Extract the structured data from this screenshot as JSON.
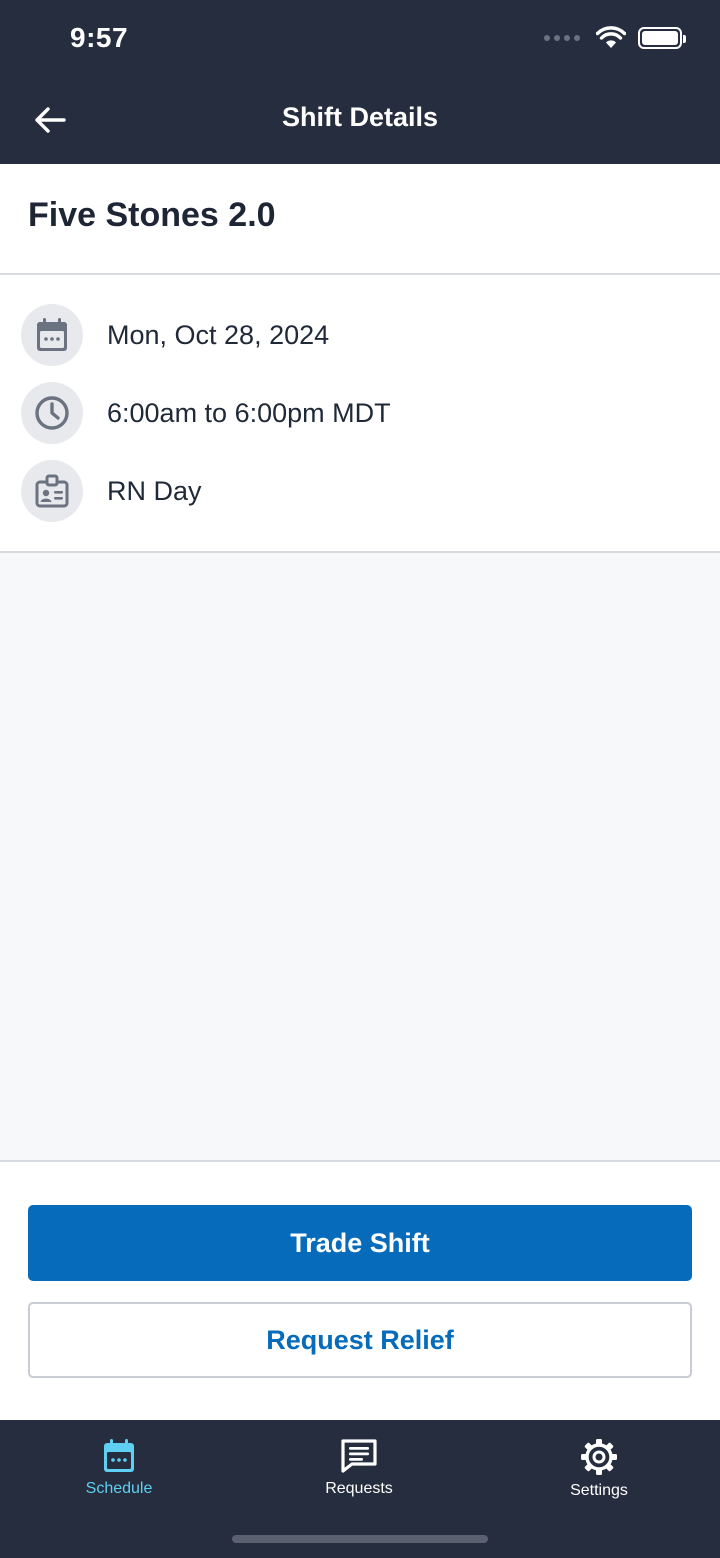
{
  "status_bar": {
    "time": "9:57"
  },
  "header": {
    "title": "Shift Details",
    "back_icon": "arrow-left-icon"
  },
  "shift": {
    "name": "Five Stones 2.0",
    "details": [
      {
        "icon": "calendar-icon",
        "text": "Mon, Oct 28, 2024"
      },
      {
        "icon": "clock-icon",
        "text": "6:00am to 6:00pm MDT"
      },
      {
        "icon": "id-badge-icon",
        "text": "RN Day"
      }
    ]
  },
  "actions": {
    "primary_label": "Trade Shift",
    "secondary_label": "Request Relief"
  },
  "tabs": [
    {
      "label": "Schedule",
      "icon": "calendar-icon",
      "active": true
    },
    {
      "label": "Requests",
      "icon": "message-icon",
      "active": false
    },
    {
      "label": "Settings",
      "icon": "gear-icon",
      "active": false
    }
  ],
  "colors": {
    "header_bg": "#252d3e",
    "primary": "#066bba",
    "active_tab": "#5fd0f2",
    "icon_bg": "#e7e9ed"
  }
}
